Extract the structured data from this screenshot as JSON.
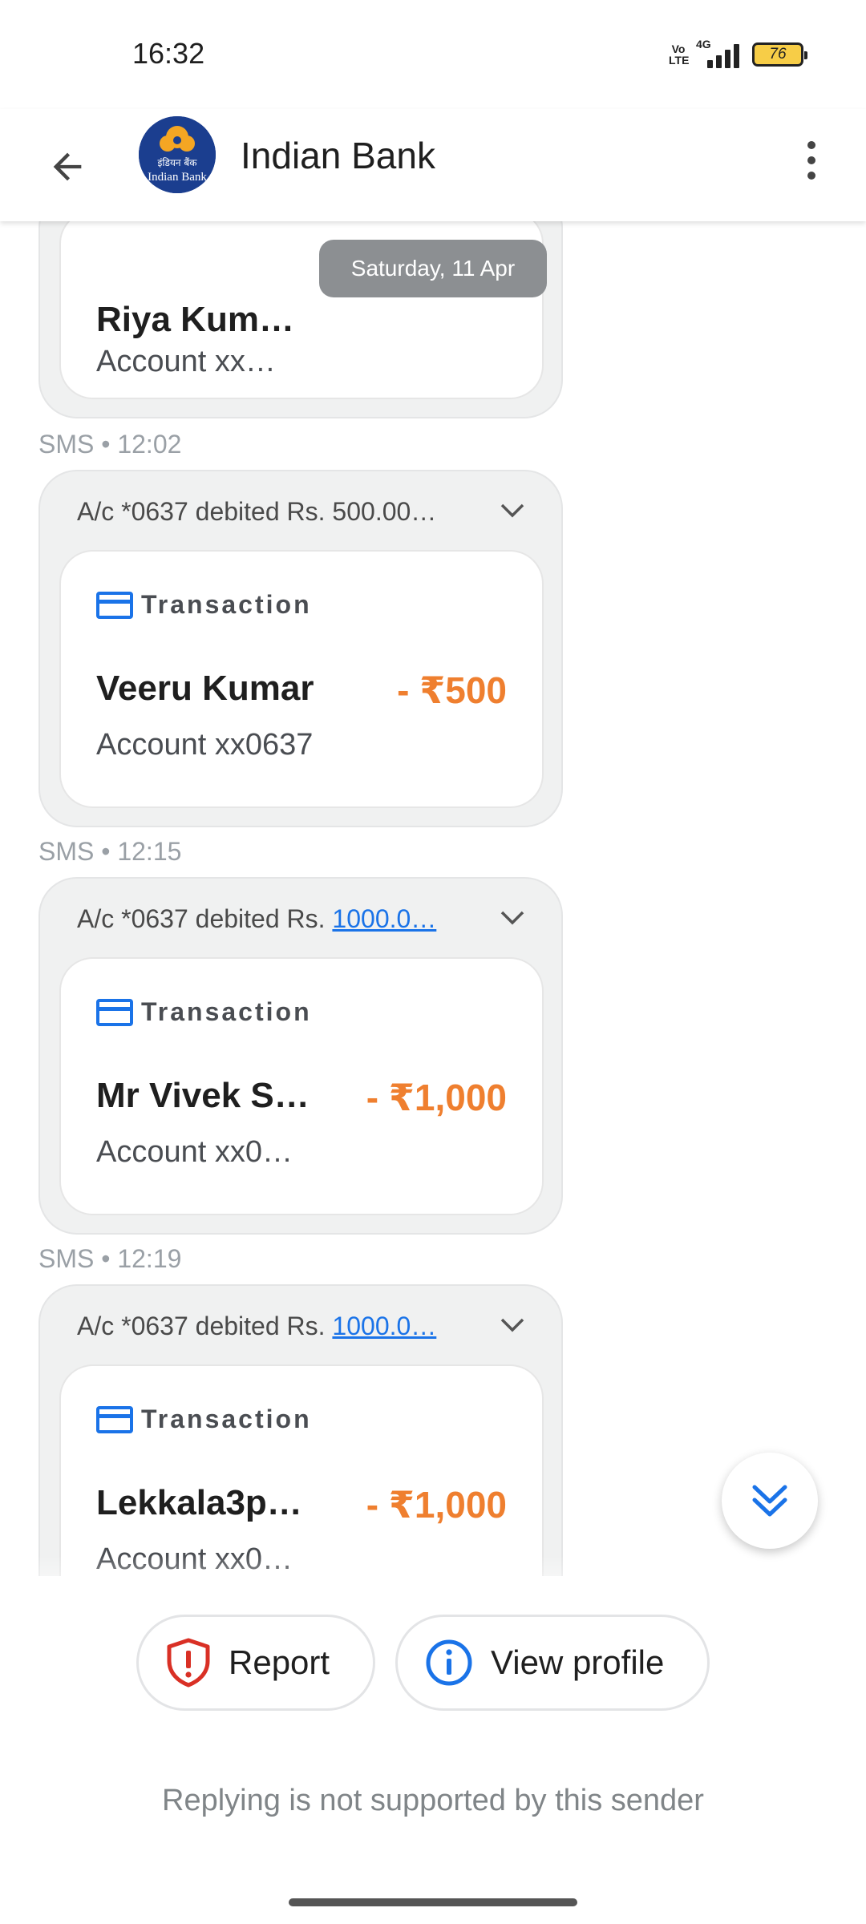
{
  "status_bar": {
    "time": "16:32",
    "volte": "Vo\nLTE",
    "network": "4G",
    "battery": "76"
  },
  "app_bar": {
    "title": "Indian Bank",
    "avatar_text": "इंडियन बैंक\nIndian Bank"
  },
  "date_chip": "Saturday, 11 Apr",
  "messages": [
    {
      "name": "Riya Kum…",
      "account": "Account xx…"
    },
    {
      "timestamp": "SMS • 12:02",
      "preview": "A/c *0637 debited Rs. 500.00…",
      "preview_link": "",
      "type_label": "Transaction",
      "name": "Veeru Kumar",
      "amount": "- ₹500",
      "account": "Account xx0637"
    },
    {
      "timestamp": "SMS • 12:15",
      "preview": "A/c *0637 debited Rs. ",
      "preview_link": "1000.0…",
      "type_label": "Transaction",
      "name": "Mr Vivek S…",
      "amount": "- ₹1,000",
      "account": "Account xx0…"
    },
    {
      "timestamp": "SMS • 12:19",
      "preview": "A/c *0637 debited Rs. ",
      "preview_link": "1000.0…",
      "type_label": "Transaction",
      "name": "Lekkala3p…",
      "amount": "- ₹1,000",
      "account": "Account xx0…"
    }
  ],
  "actions": {
    "report": "Report",
    "view_profile": "View profile"
  },
  "notice": "Replying is not supported by this sender",
  "colors": {
    "accent": "#1a73e8",
    "debit": "#ef7f2f",
    "report": "#d93025"
  }
}
